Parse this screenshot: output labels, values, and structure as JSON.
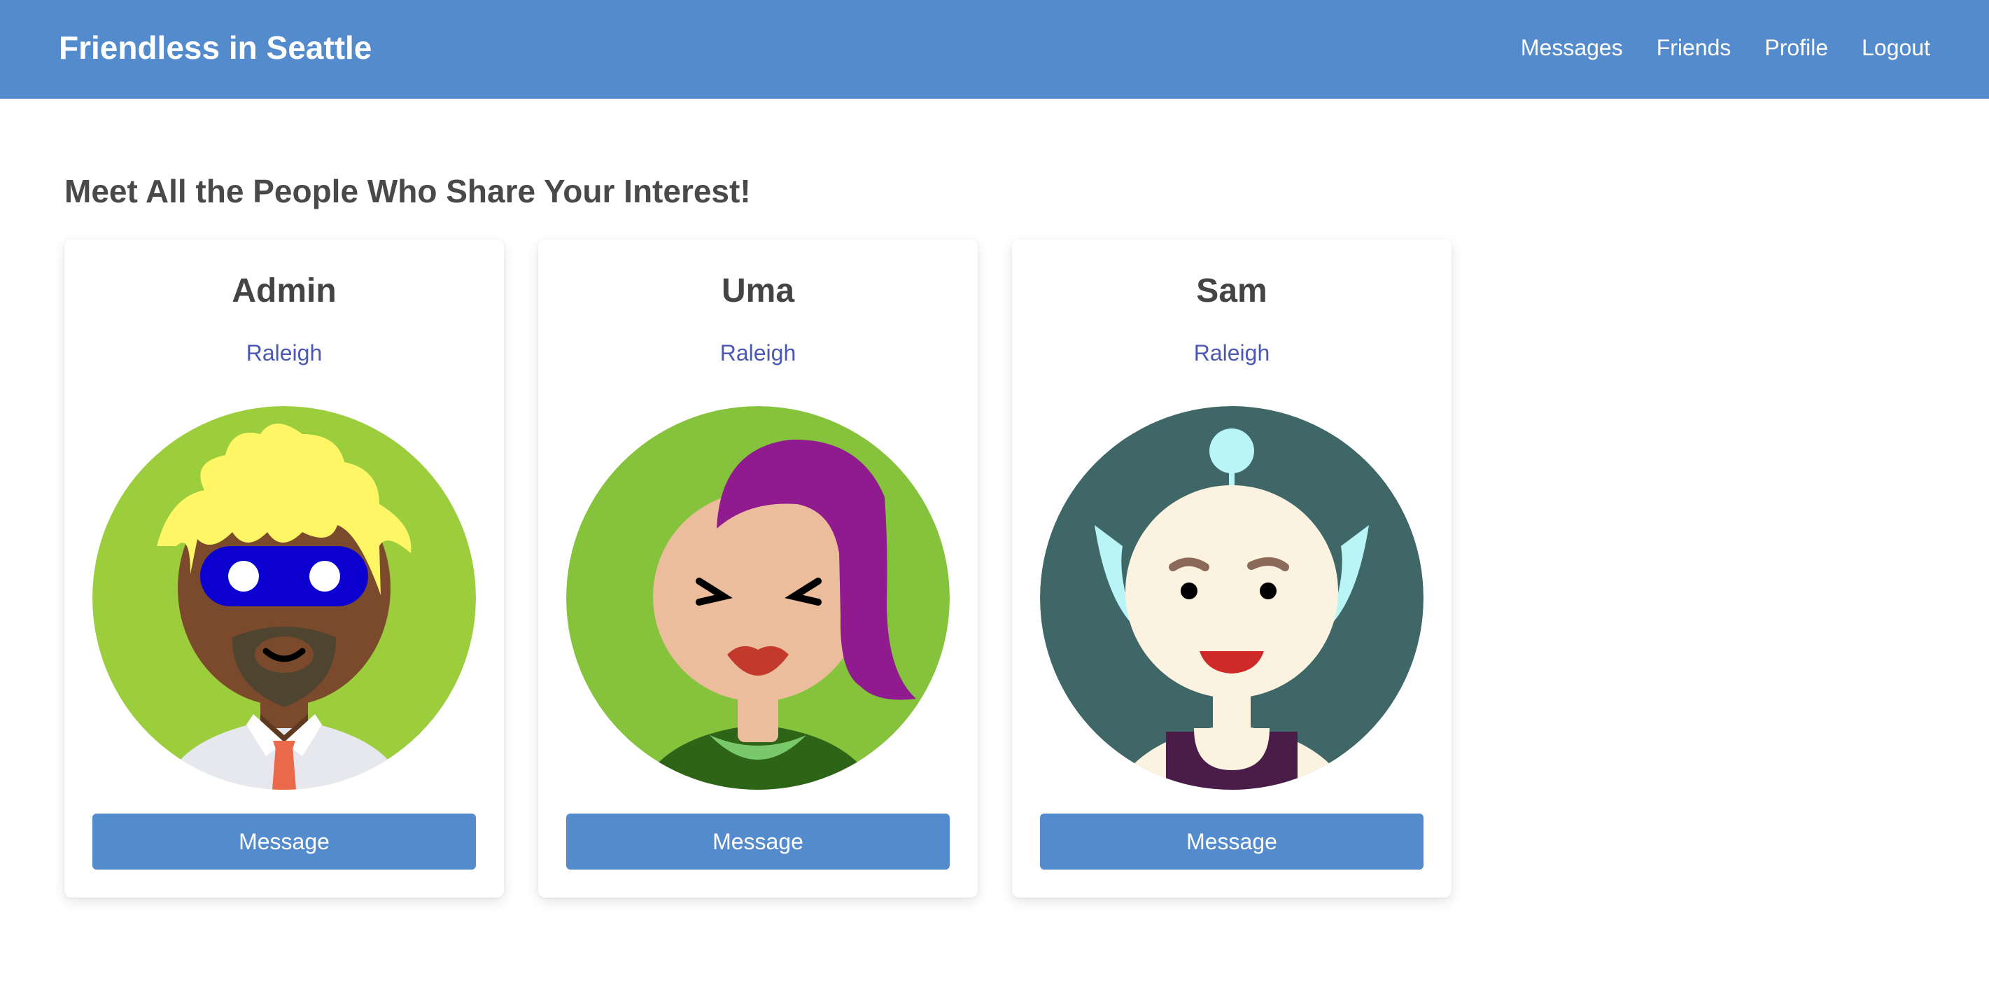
{
  "app": {
    "brand": "Friendless in Seattle"
  },
  "nav": {
    "items": [
      {
        "label": "Messages"
      },
      {
        "label": "Friends"
      },
      {
        "label": "Profile"
      },
      {
        "label": "Logout"
      }
    ]
  },
  "main": {
    "title": "Meet All the People Who Share Your Interest!"
  },
  "cards": [
    {
      "name": "Admin",
      "city": "Raleigh",
      "button": "Message",
      "avatar_icon": "admin-avatar"
    },
    {
      "name": "Uma",
      "city": "Raleigh",
      "button": "Message",
      "avatar_icon": "uma-avatar"
    },
    {
      "name": "Sam",
      "city": "Raleigh",
      "button": "Message",
      "avatar_icon": "sam-avatar"
    }
  ],
  "colors": {
    "header": "#548bcd",
    "button": "#548bcd",
    "city_link": "#4b58b6",
    "title_text": "#494949"
  }
}
